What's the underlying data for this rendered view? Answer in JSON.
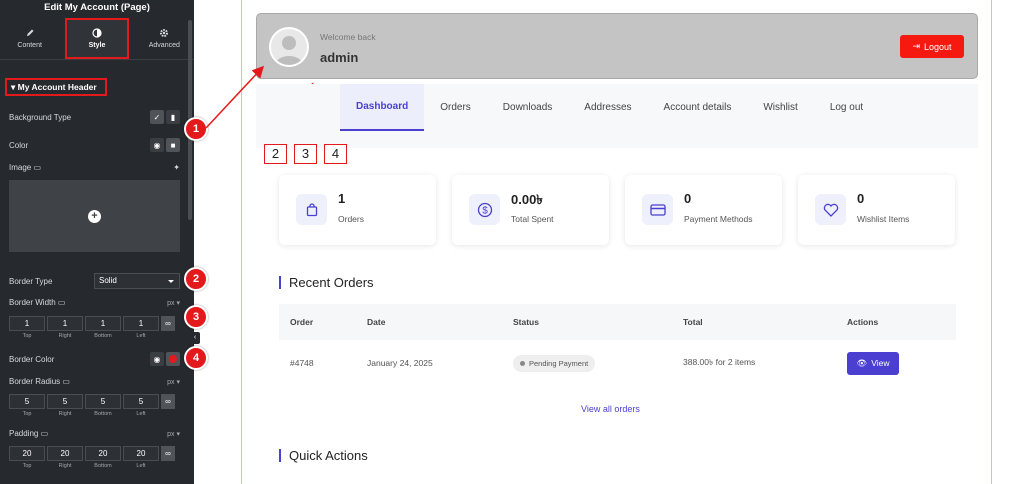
{
  "panel": {
    "title": "Edit My Account (Page)",
    "tabs": [
      {
        "label": "Content",
        "icon": "pencil-icon"
      },
      {
        "label": "Style",
        "icon": "contrast-icon"
      },
      {
        "label": "Advanced",
        "icon": "gear-icon"
      }
    ],
    "active_tab": "Style",
    "section": "My Account Header",
    "background_type_label": "Background Type",
    "color_label": "Color",
    "image_label": "Image",
    "border_type_label": "Border Type",
    "border_type_value": "Solid",
    "border_width_label": "Border Width",
    "border_width": {
      "unit": "px",
      "top": "1",
      "right": "1",
      "bottom": "1",
      "left": "1"
    },
    "border_color_label": "Border Color",
    "border_color_value": "#e4191b",
    "border_radius_label": "Border Radius",
    "border_radius": {
      "unit": "px",
      "top": "5",
      "right": "5",
      "bottom": "5",
      "left": "5"
    },
    "padding_label": "Padding",
    "padding": {
      "unit": "px",
      "top": "20",
      "right": "20",
      "bottom": "20",
      "left": "20"
    },
    "dim_labels": {
      "top": "Top",
      "right": "Right",
      "bottom": "Bottom",
      "left": "Left"
    }
  },
  "badges": [
    "1",
    "2",
    "3",
    "4"
  ],
  "ref_boxes": [
    "2",
    "3",
    "4"
  ],
  "header": {
    "welcome": "Welcome back",
    "username": "admin",
    "logout_label": "Logout",
    "background": "#c4c4c4"
  },
  "nav": {
    "items": [
      "Dashboard",
      "Orders",
      "Downloads",
      "Addresses",
      "Account details",
      "Wishlist",
      "Log out"
    ],
    "active": "Dashboard"
  },
  "stats": [
    {
      "value": "1",
      "label": "Orders",
      "icon": "bag-icon"
    },
    {
      "value": "0.00৳",
      "label": "Total Spent",
      "icon": "dollar-icon"
    },
    {
      "value": "0",
      "label": "Payment Methods",
      "icon": "card-icon"
    },
    {
      "value": "0",
      "label": "Wishlist Items",
      "icon": "heart-icon"
    }
  ],
  "recent_orders": {
    "title": "Recent Orders",
    "columns": [
      "Order",
      "Date",
      "Status",
      "Total",
      "Actions"
    ],
    "rows": [
      {
        "order": "#4748",
        "date": "January 24, 2025",
        "status": "Pending Payment",
        "total": "388.00৳  for 2 items",
        "action": "View"
      }
    ],
    "view_all": "View all orders"
  },
  "quick_actions_title": "Quick Actions",
  "accent": "#4a3fd1"
}
